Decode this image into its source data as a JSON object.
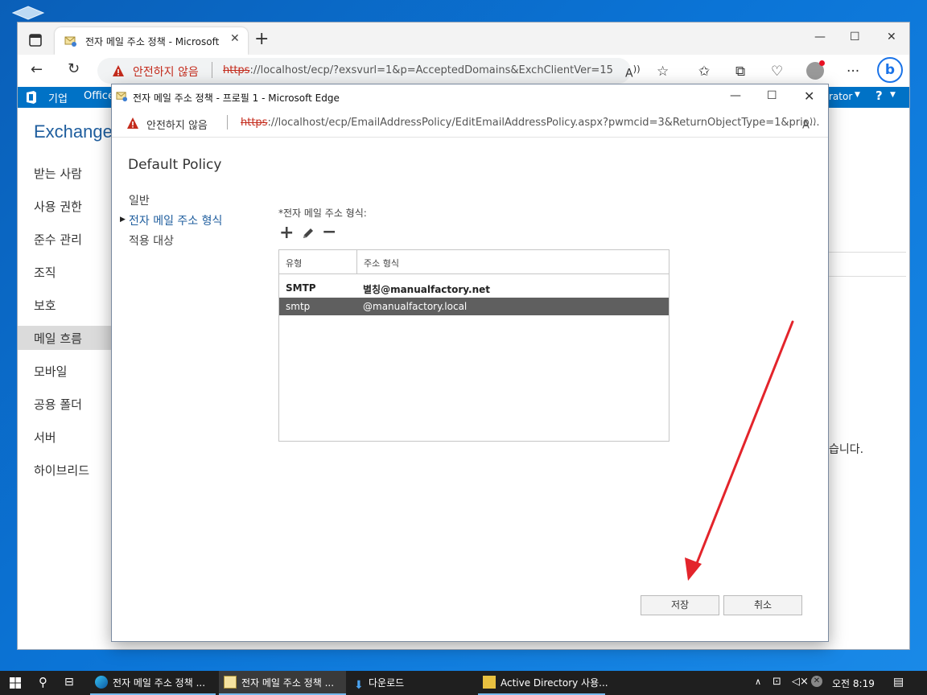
{
  "browser": {
    "tab_title": "전자 메일 주소 정책 - Microsoft Edge",
    "new_tab": "+",
    "insecure_label": "안전하지 않음",
    "url_scheme": "https",
    "url_rest": "://localhost/ecp/?exsvurl=1&p=AcceptedDomains&ExchClientVer=15"
  },
  "eac": {
    "top_bar": {
      "enterprise": "기업",
      "office": "Office",
      "admin": "rator",
      "help": "?"
    },
    "title": "Exchange",
    "nav": [
      "받는 사람",
      "사용 권한",
      "준수 관리",
      "조직",
      "보호",
      "메일 흐름",
      "모바일",
      "공용 폴더",
      "서버",
      "하이브리드"
    ],
    "bg_text": "습니다."
  },
  "popup": {
    "title": "전자 메일 주소 정책 - 프로필 1 - Microsoft Edge",
    "insecure_label": "안전하지 않음",
    "url_scheme": "https",
    "url_rest": "://localhost/ecp/EmailAddressPolicy/EditEmailAddressPolicy.aspx?pwmcid=3&ReturnObjectType=1&prio…",
    "policy_name": "Default Policy",
    "side_nav": [
      "일반",
      "전자 메일 주소 형식",
      "적용 대상"
    ],
    "format_label": "*전자 메일 주소 형식:",
    "table": {
      "headers": [
        "유형",
        "주소 형식"
      ],
      "rows": [
        {
          "type": "SMTP",
          "address": "별칭@manualfactory.net"
        },
        {
          "type": "smtp",
          "address": "@manualfactory.local"
        }
      ]
    },
    "save_label": "저장",
    "cancel_label": "취소"
  },
  "taskbar": {
    "items": [
      "전자 메일 주소 정책 ...",
      "전자 메일 주소 정책 ...",
      "다운로드",
      "Active Directory 사용..."
    ],
    "clock": "오전 8:19"
  },
  "colors": {
    "accent": "#0072c6",
    "warning": "#c42b1c",
    "selected_row": "#5f5f5f",
    "annotation": "#e3242b"
  }
}
